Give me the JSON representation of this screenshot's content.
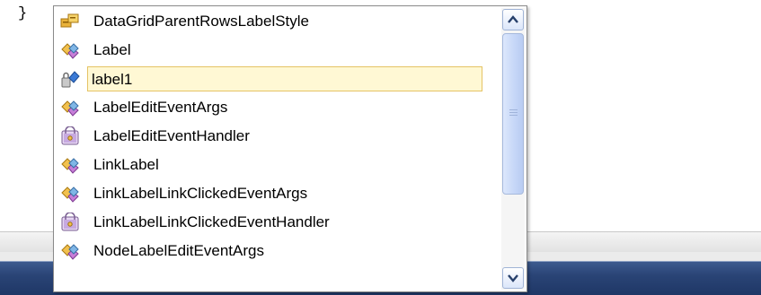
{
  "editor": {
    "brace": "}"
  },
  "completion_list": {
    "items": [
      {
        "label": "DataGridParentRowsLabelStyle",
        "icon": "enum-icon"
      },
      {
        "label": "Label",
        "icon": "class-icon"
      },
      {
        "label": "label1",
        "icon": "field-icon",
        "selected": true
      },
      {
        "label": "LabelEditEventArgs",
        "icon": "class-icon"
      },
      {
        "label": "LabelEditEventHandler",
        "icon": "delegate-icon"
      },
      {
        "label": "LinkLabel",
        "icon": "class-icon"
      },
      {
        "label": "LinkLabelLinkClickedEventArgs",
        "icon": "class-icon"
      },
      {
        "label": "LinkLabelLinkClickedEventHandler",
        "icon": "delegate-icon"
      },
      {
        "label": "NodeLabelEditEventArgs",
        "icon": "class-icon"
      }
    ]
  },
  "colors": {
    "selection_fill": "#fff8d4",
    "selection_border": "#e5c365",
    "status_bar": "#2a4476"
  }
}
